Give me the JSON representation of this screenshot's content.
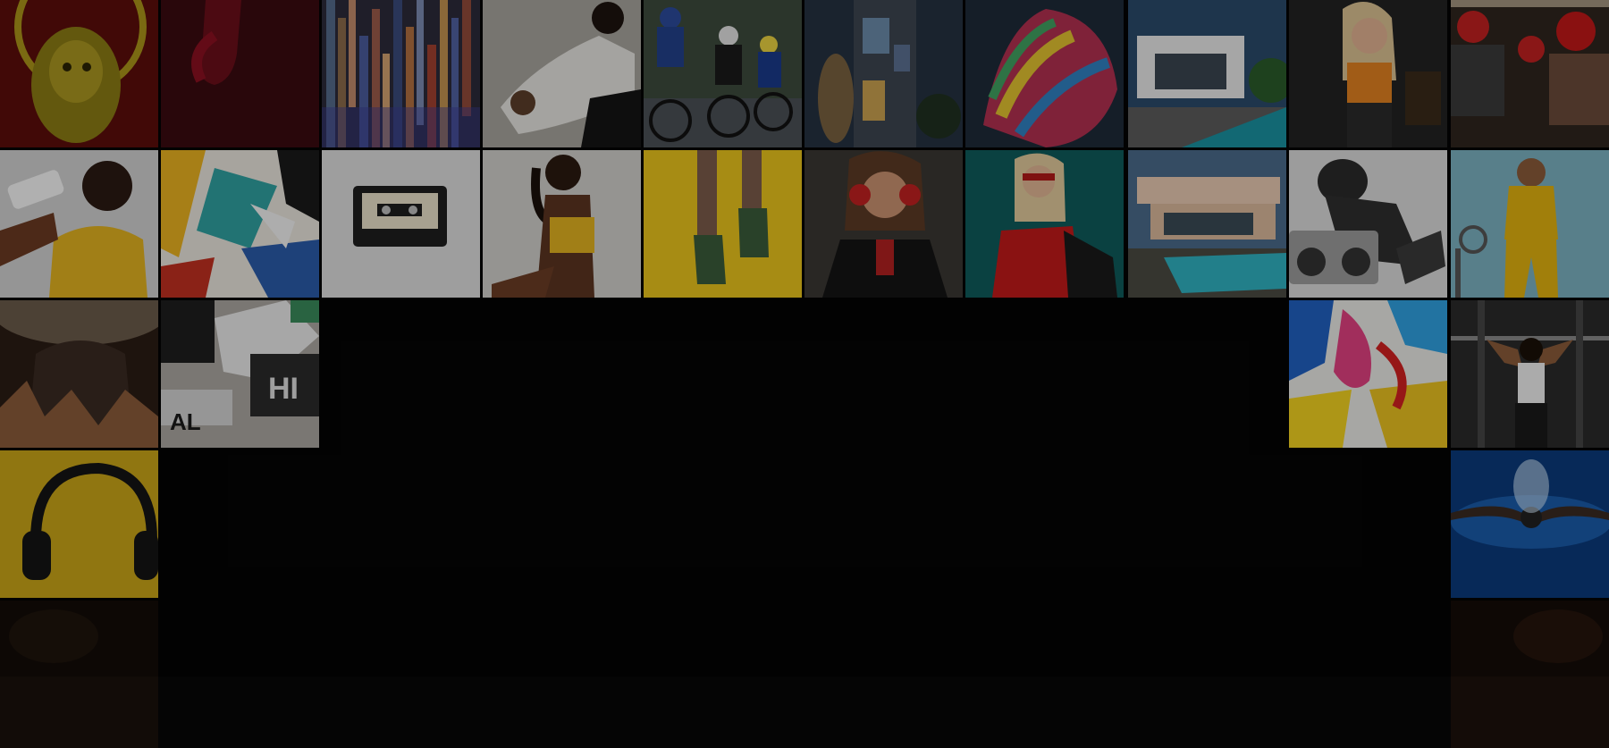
{
  "gallery": {
    "rows": [
      [
        "gold-lion-sculpture",
        "red-hand",
        "colorful-wood-strips",
        "woman-in-white-lying",
        "cycling-race",
        "modern-house-evening",
        "painted-hands",
        "white-villa-pool",
        "woman-orange-top",
        "boxers-red-gloves"
      ],
      [
        "woman-drinking-bottle",
        "abstract-geometric-painting",
        "cassette-tape",
        "woman-yellow-top-sitting",
        "legs-on-yellow",
        "woman-red-headphones",
        "woman-red-shirt",
        "villa-pool",
        "person-with-boombox",
        "woman-yellow-tracksuit"
      ],
      [
        "concert-hands",
        "torn-posters",
        "",
        "",
        "",
        "",
        "",
        "",
        "paint-splash-art",
        "athlete-pullup"
      ],
      [
        "headphones-on-yellow",
        "",
        "",
        "",
        "",
        "",
        "",
        "",
        "",
        "swimmer-butterfly"
      ]
    ]
  }
}
